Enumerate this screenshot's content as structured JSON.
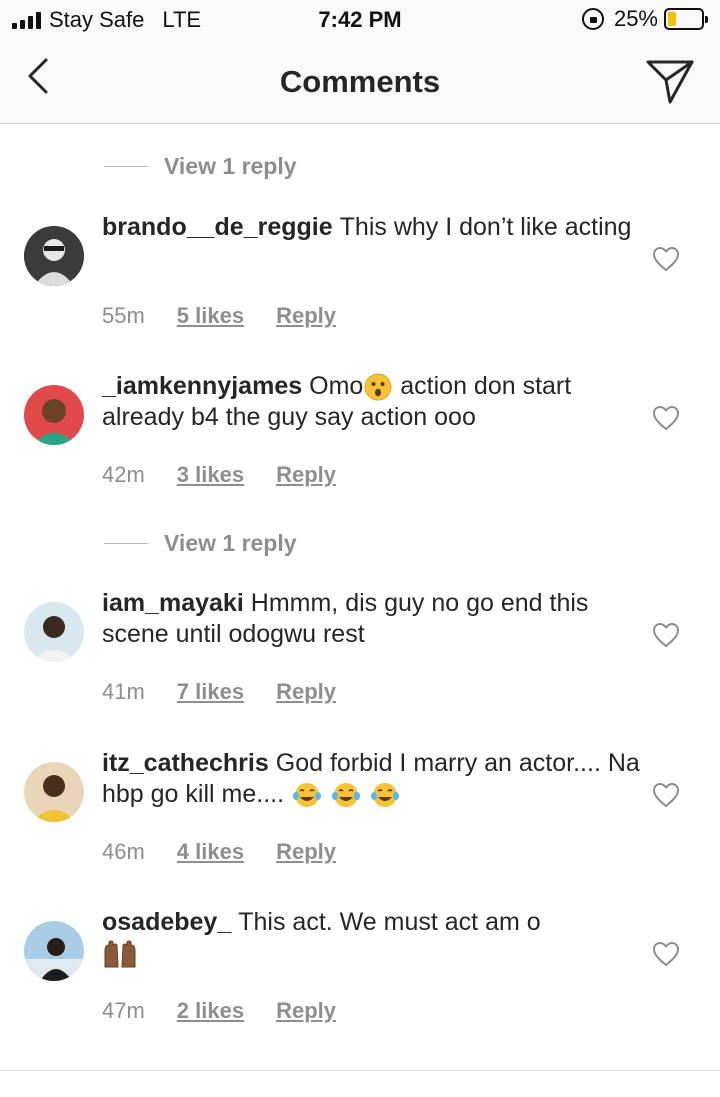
{
  "status_bar": {
    "carrier": "Stay Safe",
    "network": "LTE",
    "time": "7:42 PM",
    "battery": "25%",
    "battery_level": 0.25,
    "battery_color": "#f2c200"
  },
  "nav": {
    "title": "Comments",
    "back_icon": "chevron-left-icon",
    "share_icon": "paper-plane-icon"
  },
  "view_replies": [
    {
      "label": "View 1 reply"
    },
    {
      "label": "View 1 reply"
    }
  ],
  "comments": [
    {
      "username": "brando__de_reggie",
      "text": "This why I don’t like acting",
      "time": "55m",
      "likes": "5 likes",
      "reply_label": "Reply"
    },
    {
      "username": "_iamkennyjames",
      "text_before_emoji": "Omo",
      "emoji": "surprised-face-emoji",
      "text": " action don start already b4 the guy say action ooo",
      "time": "42m",
      "likes": "3 likes",
      "reply_label": "Reply"
    },
    {
      "username": "iam_mayaki",
      "text": "Hmmm, dis guy no go end this scene until odogwu rest",
      "time": "41m",
      "likes": "7 likes",
      "reply_label": "Reply"
    },
    {
      "username": "itz_cathechris",
      "text": "God forbid I marry an actor.... Na hbp go kill me....",
      "emoji": "tears-of-joy-emoji",
      "time": "46m",
      "likes": "4 likes",
      "reply_label": "Reply"
    },
    {
      "username": "osadebey_",
      "text": "This act. We must act am o",
      "emoji": "raising-hands-emoji",
      "time": "47m",
      "likes": "2 likes",
      "reply_label": "Reply"
    }
  ],
  "colors": {
    "text": "#262626",
    "secondary": "#8e8e8e",
    "bar_background": "#f9f9f9"
  }
}
